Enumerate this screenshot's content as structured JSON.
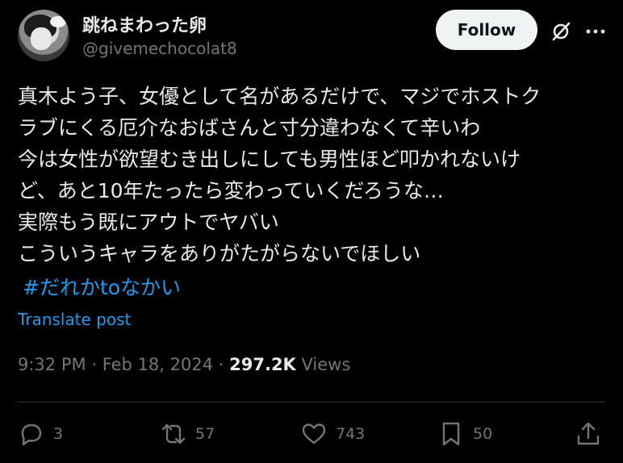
{
  "author": {
    "display_name": "跳ねまわった卵",
    "handle": "@givemechocolat8"
  },
  "header": {
    "follow_label": "Follow",
    "grok_icon": "grok-slash-icon",
    "more_icon": "more-dots-icon"
  },
  "tweet": {
    "lines": [
      "真木よう子、女優として名があるだけで、マジでホストク",
      "ラブにくる厄介なおばさんと寸分違わなくて辛いわ",
      "今は女性が欲望むき出しにしても男性ほど叩かれないけ",
      "ど、あと10年たったら変わっていくだろうな…",
      "実際もう既にアウトでヤバい",
      "こういうキャラをありがたがらないでほしい"
    ],
    "hashtag": "#だれかtoなかい",
    "translate_label": "Translate post"
  },
  "meta": {
    "time": "9:32 PM",
    "separator": "·",
    "date": "Feb 18, 2024",
    "views_count": "297.2K",
    "views_label": "Views"
  },
  "actions": {
    "reply": {
      "icon": "reply-icon",
      "count": "3"
    },
    "repost": {
      "icon": "repost-icon",
      "count": "57"
    },
    "like": {
      "icon": "heart-icon",
      "count": "743"
    },
    "bookmark": {
      "icon": "bookmark-icon",
      "count": "50"
    },
    "share": {
      "icon": "share-icon"
    }
  },
  "colors": {
    "background": "#000000",
    "text": "#e7e9ea",
    "secondary": "#71767b",
    "link": "#1d9bf0",
    "divider": "#2f3336",
    "follow_bg": "#eff3f4"
  }
}
